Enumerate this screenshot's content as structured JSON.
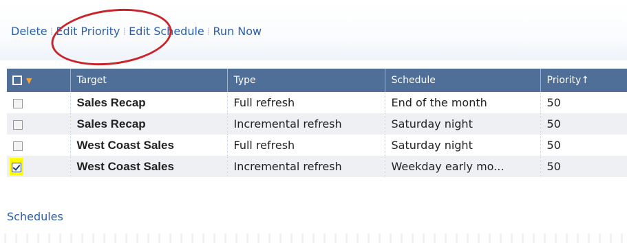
{
  "toolbar": {
    "delete_label": "Delete",
    "edit_priority_label": "Edit Priority",
    "edit_schedule_label": "Edit Schedule",
    "run_now_label": "Run Now"
  },
  "grid": {
    "headers": {
      "target": "Target",
      "type": "Type",
      "schedule": "Schedule",
      "priority": "Priority↑"
    },
    "rows": [
      {
        "checked": false,
        "target": "Sales Recap",
        "type": "Full refresh",
        "schedule": "End of the month",
        "priority": "50"
      },
      {
        "checked": false,
        "target": "Sales Recap",
        "type": "Incremental refresh",
        "schedule": "Saturday night",
        "priority": "50"
      },
      {
        "checked": false,
        "target": "West Coast Sales",
        "type": "Full refresh",
        "schedule": "Saturday night",
        "priority": "50"
      },
      {
        "checked": true,
        "target": "West Coast Sales",
        "type": "Incremental refresh",
        "schedule": "Weekday early mo...",
        "priority": "50"
      }
    ]
  },
  "footer": {
    "schedules_label": "Schedules"
  },
  "colors": {
    "header_bg": "#4f6f98",
    "link": "#2a5ea8",
    "annotation_circle": "#c8242a",
    "checkbox_highlight": "#ffff00"
  }
}
